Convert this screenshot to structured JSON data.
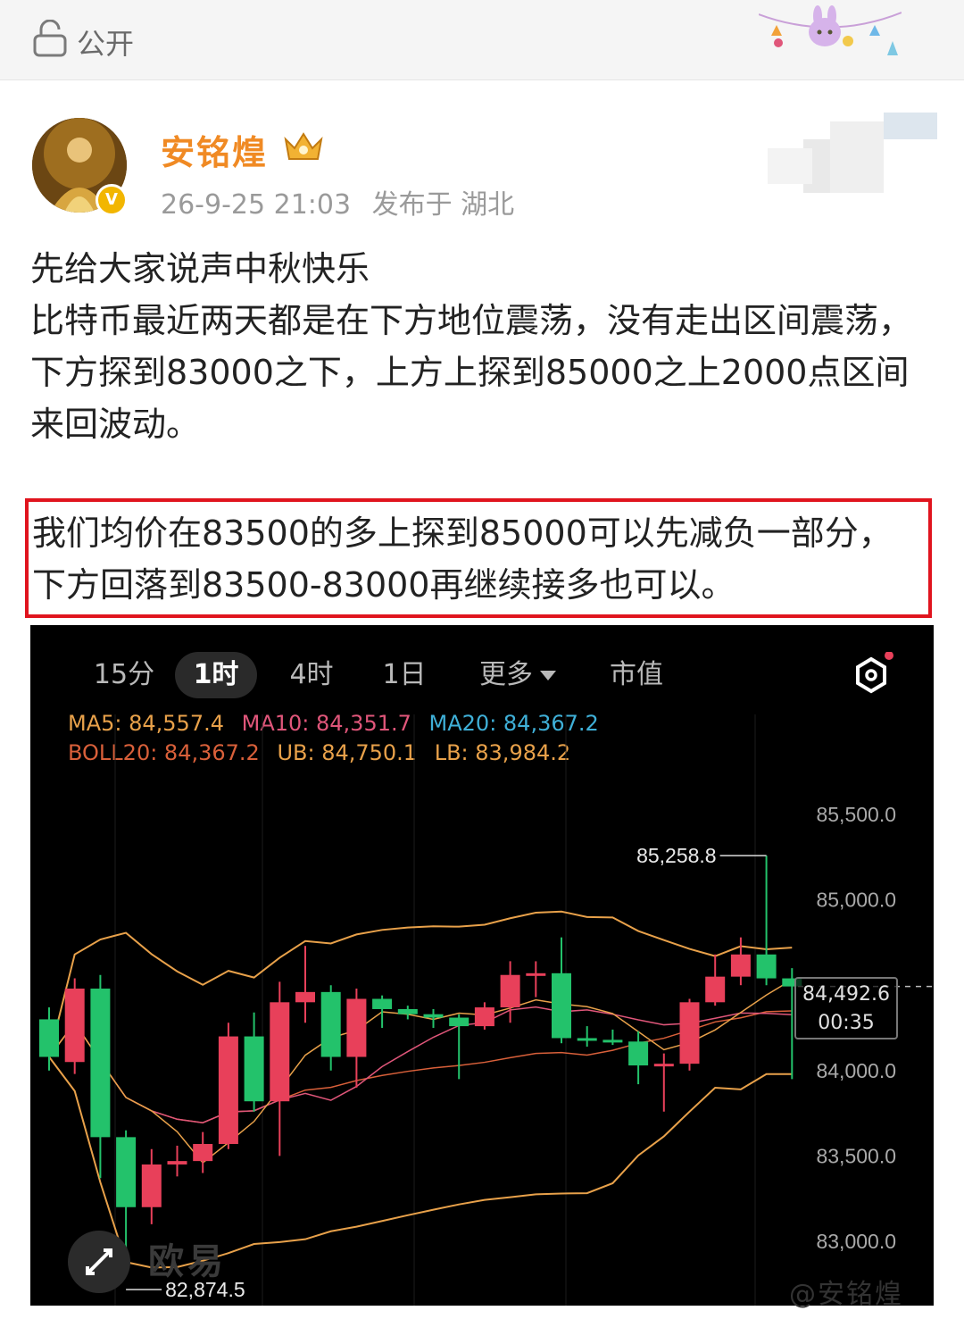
{
  "topbar": {
    "visibility_label": "公开",
    "lock_icon": "lock-icon",
    "decoration": "party-decoration-icon"
  },
  "author": {
    "name": "安铭煌",
    "verified_icon": "verified-badge-icon",
    "level_icon": "crown-badge-icon",
    "date": "26-9-25 21:03",
    "location_label": "发布于 湖北",
    "accent": "#f08a24"
  },
  "post": {
    "line1": "先给大家说声中秋快乐",
    "line2": "比特币最近两天都是在下方地位震荡，没有走出区间震荡，下方探到83000之下，上方上探到85000之上2000点区间来回波动。",
    "highlight": "我们均价在83500的多上探到85000可以先减负一部分，下方回落到83500-83000再继续接多也可以。",
    "highlight_color": "#e0141e"
  },
  "chart": {
    "tabs": [
      {
        "label": "15分",
        "active": false
      },
      {
        "label": "1时",
        "active": true
      },
      {
        "label": "4时",
        "active": false
      },
      {
        "label": "1日",
        "active": false
      },
      {
        "label": "更多",
        "active": false
      },
      {
        "label": "市值",
        "active": false
      }
    ],
    "settings_icon": "hexagon-settings-icon",
    "indicators_row1": [
      {
        "text": "MA5: 84,557.4",
        "color": "#e8a14a"
      },
      {
        "text": "MA10: 84,351.7",
        "color": "#e0567a"
      },
      {
        "text": "MA20: 84,367.2",
        "color": "#3fb0d8"
      }
    ],
    "indicators_row2": [
      {
        "text": "BOLL20: 84,367.2",
        "color": "#d9603a"
      },
      {
        "text": "UB: 84,750.1",
        "color": "#e8a14a"
      },
      {
        "text": "LB: 83,984.2",
        "color": "#e8a14a"
      }
    ],
    "current_price": "84,492.6",
    "countdown": "00:35",
    "watermark": "欧易",
    "expand_icon": "expand-arrows-icon"
  },
  "chart_data": {
    "type": "candlestick",
    "title": "",
    "interval": "1时",
    "y_ticks": [
      "85,500.0",
      "85,000.0",
      "84,000.0",
      "83,500.0",
      "83,000.0"
    ],
    "y_tick_values": [
      85500,
      85000,
      84000,
      83500,
      83000
    ],
    "ylim": [
      82800,
      85900
    ],
    "high_label": "85,258.8",
    "high_value": 85258.8,
    "low_label": "82,874.5",
    "low_value": 82874.5,
    "candles": [
      {
        "o": 84300,
        "c": 84080,
        "h": 84370,
        "l": 84000
      },
      {
        "o": 84050,
        "c": 84480,
        "h": 84540,
        "l": 83980
      },
      {
        "o": 84480,
        "c": 83610,
        "h": 84560,
        "l": 83370
      },
      {
        "o": 83610,
        "c": 83200,
        "h": 83650,
        "l": 82874.5
      },
      {
        "o": 83200,
        "c": 83450,
        "h": 83540,
        "l": 83100
      },
      {
        "o": 83450,
        "c": 83470,
        "h": 83560,
        "l": 83380
      },
      {
        "o": 83470,
        "c": 83570,
        "h": 83640,
        "l": 83400
      },
      {
        "o": 83570,
        "c": 84200,
        "h": 84280,
        "l": 83540
      },
      {
        "o": 84200,
        "c": 83820,
        "h": 84340,
        "l": 83760
      },
      {
        "o": 83820,
        "c": 84400,
        "h": 84520,
        "l": 83500
      },
      {
        "o": 84400,
        "c": 84460,
        "h": 84730,
        "l": 84280
      },
      {
        "o": 84460,
        "c": 84080,
        "h": 84500,
        "l": 84000
      },
      {
        "o": 84080,
        "c": 84420,
        "h": 84480,
        "l": 83900
      },
      {
        "o": 84420,
        "c": 84360,
        "h": 84440,
        "l": 84250
      },
      {
        "o": 84360,
        "c": 84330,
        "h": 84380,
        "l": 84300
      },
      {
        "o": 84330,
        "c": 84310,
        "h": 84360,
        "l": 84250
      },
      {
        "o": 84310,
        "c": 84260,
        "h": 84330,
        "l": 83950
      },
      {
        "o": 84260,
        "c": 84370,
        "h": 84400,
        "l": 84240
      },
      {
        "o": 84370,
        "c": 84560,
        "h": 84640,
        "l": 84280
      },
      {
        "o": 84560,
        "c": 84570,
        "h": 84640,
        "l": 84430
      },
      {
        "o": 84570,
        "c": 84190,
        "h": 84780,
        "l": 84160
      },
      {
        "o": 84190,
        "c": 84180,
        "h": 84260,
        "l": 84140
      },
      {
        "o": 84180,
        "c": 84170,
        "h": 84240,
        "l": 84150
      },
      {
        "o": 84170,
        "c": 84030,
        "h": 84230,
        "l": 83920
      },
      {
        "o": 84030,
        "c": 84040,
        "h": 84100,
        "l": 83760
      },
      {
        "o": 84040,
        "c": 84400,
        "h": 84420,
        "l": 84000
      },
      {
        "o": 84400,
        "c": 84550,
        "h": 84680,
        "l": 84380
      },
      {
        "o": 84550,
        "c": 84680,
        "h": 84780,
        "l": 84500
      },
      {
        "o": 84680,
        "c": 84540,
        "h": 85258.8,
        "l": 84500
      },
      {
        "o": 84540,
        "c": 84492.6,
        "h": 84600,
        "l": 83950
      }
    ],
    "up_color": "#e8405a",
    "down_color": "#23c26b"
  },
  "footer": {
    "watermark": "@安铭煌"
  }
}
